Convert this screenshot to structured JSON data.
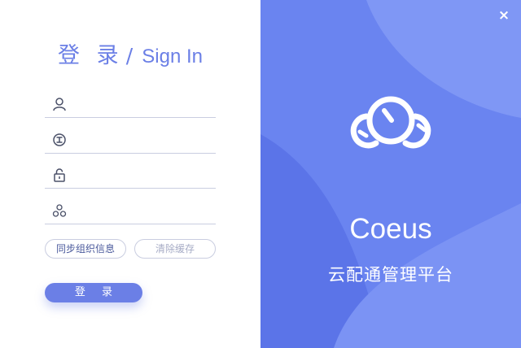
{
  "login": {
    "title_cn": "登 录",
    "title_sep": "/",
    "title_en": "Sign In",
    "fields": [
      {
        "icon": "user-icon",
        "value": "",
        "placeholder": ""
      },
      {
        "icon": "org-code-icon",
        "value": "",
        "placeholder": ""
      },
      {
        "icon": "lock-icon",
        "value": "",
        "placeholder": ""
      },
      {
        "icon": "group-icon",
        "value": "",
        "placeholder": ""
      }
    ],
    "sync_label": "同步组织信息",
    "clear_cache_label": "清除缓存",
    "login_label": "登 录"
  },
  "brand": {
    "close_label": "×",
    "name": "Coeus",
    "subtitle": "云配通管理平台",
    "logo_icon": "coeus-cloud-logo-icon"
  },
  "colors": {
    "accent": "#6b7fe6",
    "panel_bg": "#6a84f0",
    "panel_light": "#7f97f5",
    "panel_dark": "#5b74e8",
    "border": "#c9cde0"
  }
}
